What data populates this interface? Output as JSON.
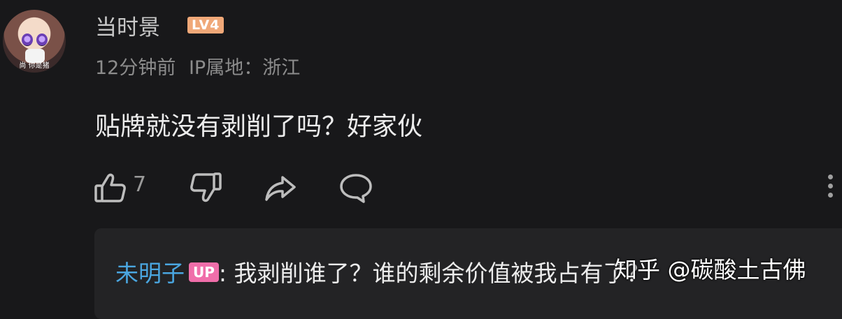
{
  "comment": {
    "avatar_caption": "尚 你是猪",
    "username": "当时景",
    "level": "LV4",
    "time": "12分钟前",
    "ip_label": "IP属地：浙江",
    "text": "贴牌就没有剥削了吗？好家伙",
    "likes": "7",
    "icons": [
      "thumbs-up-icon",
      "thumbs-down-icon",
      "share-icon",
      "reply-icon",
      "more-icon"
    ]
  },
  "reply": {
    "username": "未明子",
    "badge": "UP",
    "separator": ":",
    "text": " 我剥削谁了？谁的剩余价值被我占有了？"
  },
  "watermark": "知乎 @碳酸土古佛"
}
